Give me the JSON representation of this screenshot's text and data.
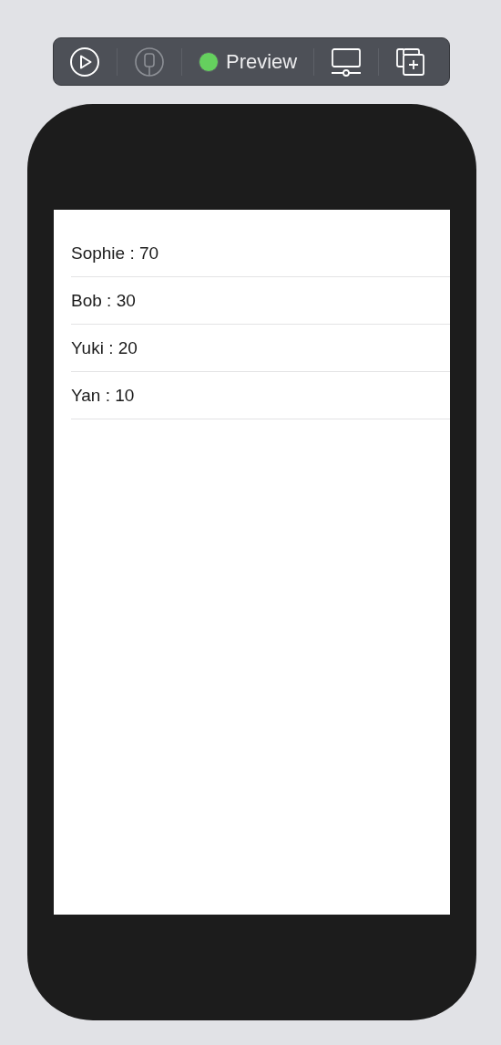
{
  "toolbar": {
    "live": true,
    "device_enabled": false,
    "label": "Preview"
  },
  "list": {
    "rows": [
      {
        "text": "Sophie : 70"
      },
      {
        "text": "Bob : 30"
      },
      {
        "text": "Yuki : 20"
      },
      {
        "text": "Yan : 10"
      }
    ]
  }
}
